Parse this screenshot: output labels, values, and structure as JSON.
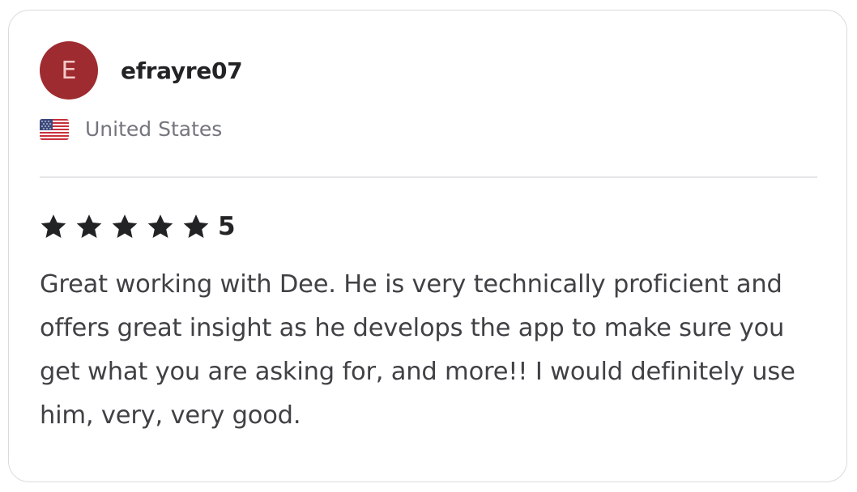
{
  "reviewer": {
    "avatar_initial": "E",
    "avatar_color": "#9e2b2f",
    "username": "efrayre07",
    "country": "United States",
    "flag_icon": "us-flag-icon"
  },
  "rating": {
    "stars": 5,
    "max_stars": 5,
    "value_label": "5",
    "star_color": "#222325"
  },
  "review": {
    "text": "Great working with Dee. He is very technically proficient and offers great insight as he develops the app to make sure you get what you are asking for, and more!! I would definitely use him, very, very good."
  }
}
